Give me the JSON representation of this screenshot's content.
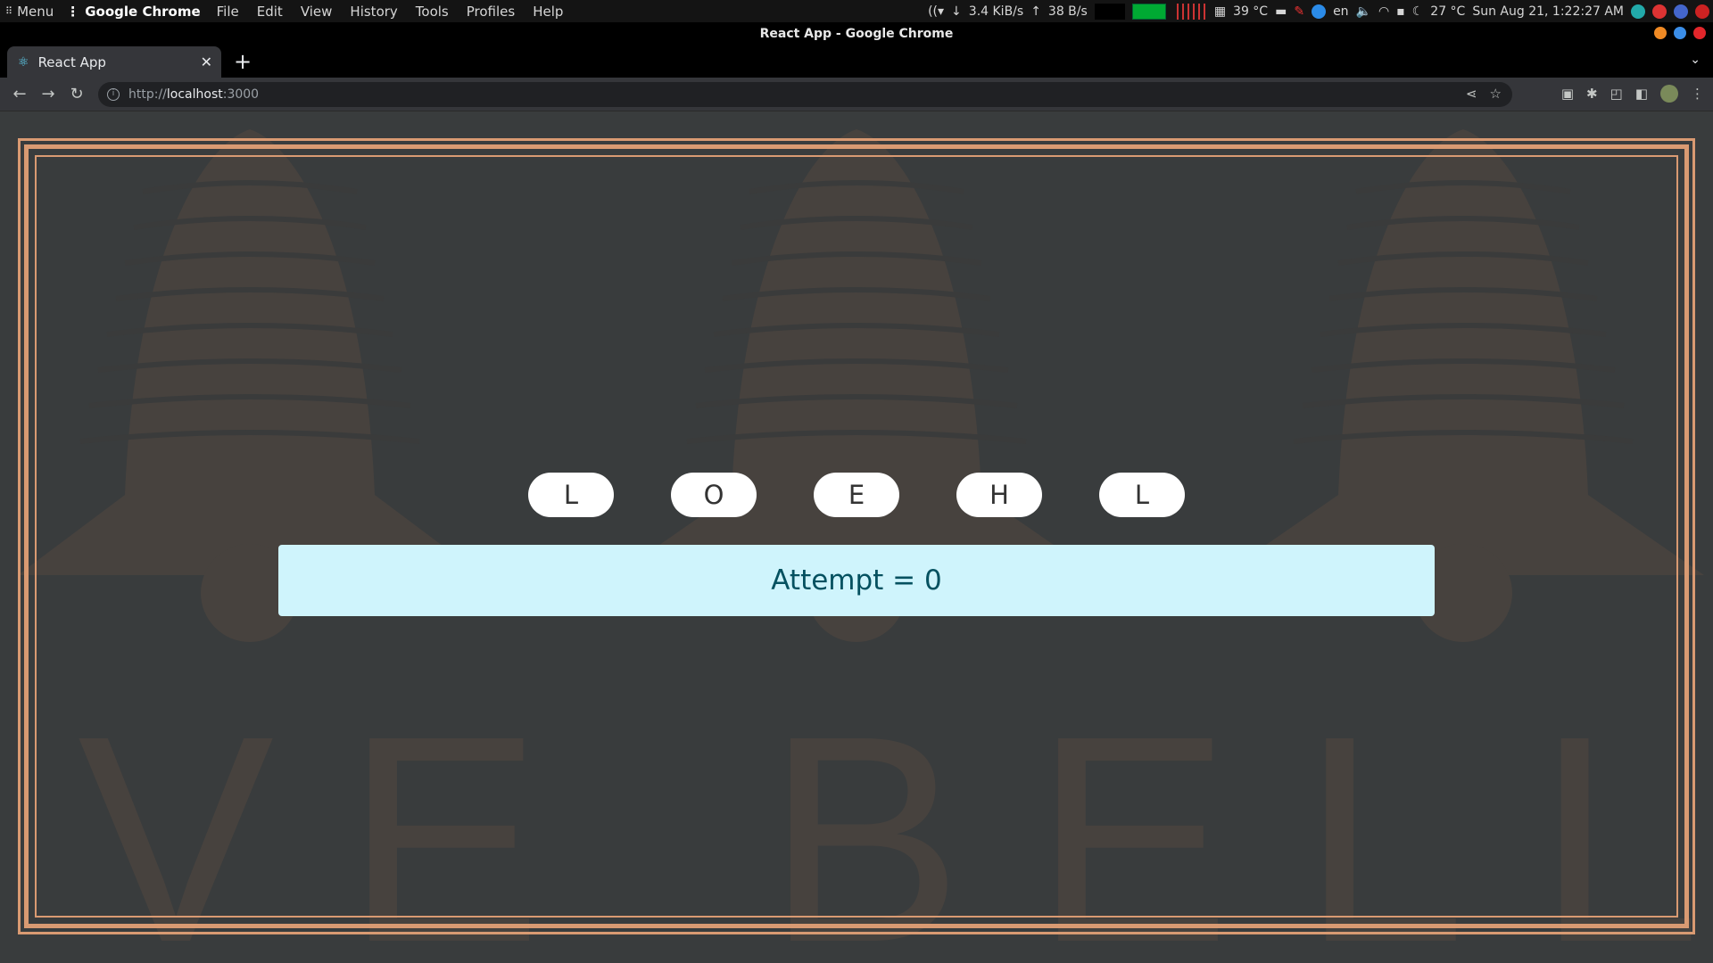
{
  "system_bar": {
    "menu_label": "Menu",
    "app_name": "Google Chrome",
    "menu_items": [
      "File",
      "Edit",
      "View",
      "History",
      "Tools",
      "Profiles",
      "Help"
    ],
    "net_down": "3.4 KiB/s",
    "net_up": "38 B/s",
    "cpu_temp": "39 °C",
    "keyboard_layout": "en",
    "weather_temp": "27 °C",
    "datetime": "Sun Aug 21,  1:22:27 AM"
  },
  "window": {
    "title": "React App - Google Chrome"
  },
  "tabs": [
    {
      "label": "React App",
      "favicon": "react-atom-icon"
    }
  ],
  "toolbar": {
    "url_scheme": "http://",
    "url_host": "localhost",
    "url_port": ":3000"
  },
  "game": {
    "letters": [
      "L",
      "O",
      "E",
      "H",
      "L"
    ],
    "attempt_text": "Attempt = 0",
    "background_text": "FIVE BELLS"
  },
  "colors": {
    "frame": "#d99a72",
    "page_bg": "#393c3d",
    "alert_bg": "#cff4fc",
    "alert_text": "#055160"
  }
}
